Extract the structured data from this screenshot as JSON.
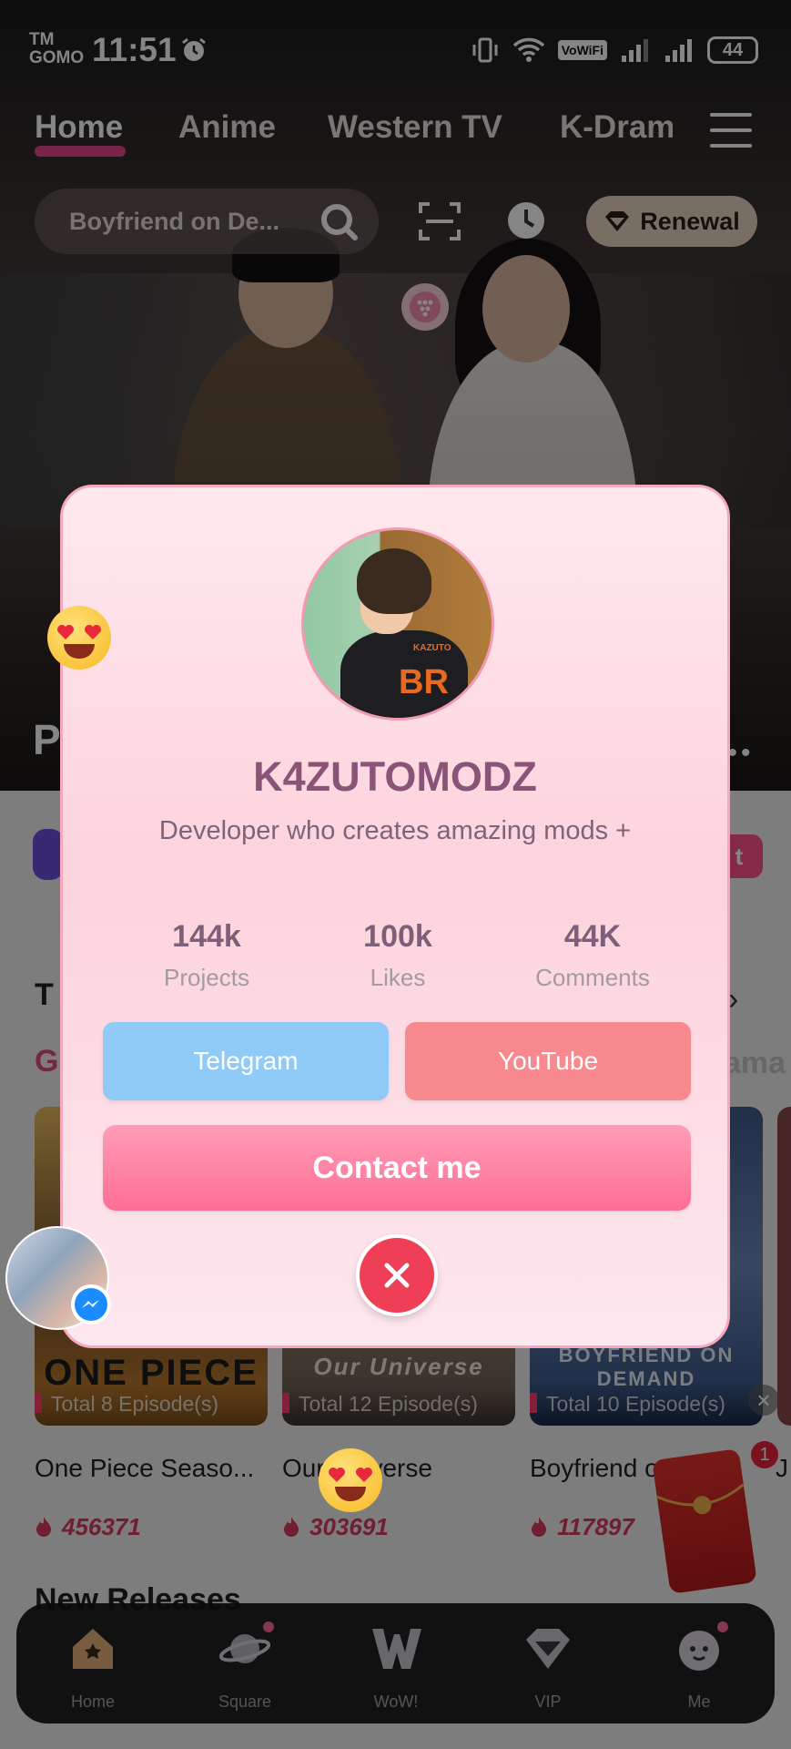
{
  "status_bar": {
    "carrier_top": "TM",
    "carrier_bottom": "GOMO",
    "time": "11:51",
    "vowifi": "VoWiFi",
    "battery": "44"
  },
  "nav": {
    "tabs": [
      "Home",
      "Anime",
      "Western TV",
      "K-Dram"
    ]
  },
  "search": {
    "placeholder": "Boyfriend on De..."
  },
  "renewal_label": "Renewal",
  "hero": {
    "partial_title": "P"
  },
  "feed": {
    "partial_tag": "t",
    "partial_T": "T",
    "partial_G": "G",
    "partial_ama": "ama",
    "new_releases": "New Releases",
    "cards": [
      {
        "brand": "ONE PIECE",
        "episodes": "Total 8 Episode(s)",
        "title": "One Piece Seaso...",
        "views": "456371"
      },
      {
        "brand": "Our Universe",
        "episodes": "Total 12 Episode(s)",
        "title": "Our Universe",
        "views": "303691"
      },
      {
        "brand": "BOYFRIEND ON DEMAND",
        "episodes": "Total 10 Episode(s)",
        "title": "Boyfriend o...",
        "views": "117897"
      }
    ],
    "partial_fourth_title": "J",
    "red_packet_badge": "1"
  },
  "bottom_nav": [
    {
      "label": "Home",
      "icon": "home-icon"
    },
    {
      "label": "Square",
      "icon": "planet-icon"
    },
    {
      "label": "WoW!",
      "icon": "wow-icon"
    },
    {
      "label": "VIP",
      "icon": "diamond-icon"
    },
    {
      "label": "Me",
      "icon": "face-icon"
    }
  ],
  "modal": {
    "name": "K4ZUTOMODZ",
    "description": "Developer who creates amazing mods +",
    "avatar_text": "BR",
    "avatar_small_text": "KAZUTO",
    "stats": [
      {
        "value": "144k",
        "label": "Projects"
      },
      {
        "value": "100k",
        "label": "Likes"
      },
      {
        "value": "44K",
        "label": "Comments"
      }
    ],
    "telegram_label": "Telegram",
    "youtube_label": "YouTube",
    "contact_label": "Contact me"
  },
  "colors": {
    "accent_pink": "#e6448a",
    "telegram_blue": "#8fcbf6",
    "youtube_red": "#f8898e",
    "contact_pink": "#ff6e94",
    "close_red": "#ee3f56"
  }
}
